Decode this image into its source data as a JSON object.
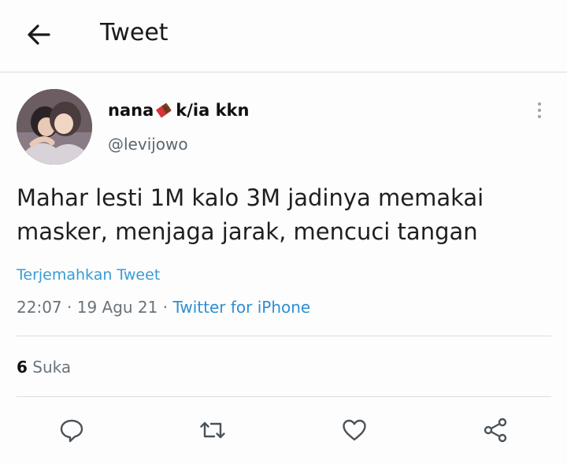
{
  "header": {
    "title": "Tweet",
    "back_icon": "back-arrow-icon"
  },
  "tweet": {
    "author_name": "nana",
    "author_name_suffix": "k/ia kkn",
    "author_emoji": "chocolate-bar-icon",
    "handle": "@levijowo",
    "text": "Mahar lesti 1M kalo 3M jadinya memakai masker, menjaga jarak, mencuci tangan",
    "translate_label": "Terjemahkan Tweet",
    "time": "22:07",
    "date": "19 Agu 21",
    "source": "Twitter for iPhone",
    "likes_count": "6",
    "likes_label": "Suka"
  },
  "actions": [
    {
      "icon": "reply-icon"
    },
    {
      "icon": "retweet-icon"
    },
    {
      "icon": "like-icon"
    },
    {
      "icon": "share-icon"
    }
  ],
  "colors": {
    "link": "#3a9bd5",
    "muted": "#6a737b",
    "divider": "#dddddd"
  }
}
